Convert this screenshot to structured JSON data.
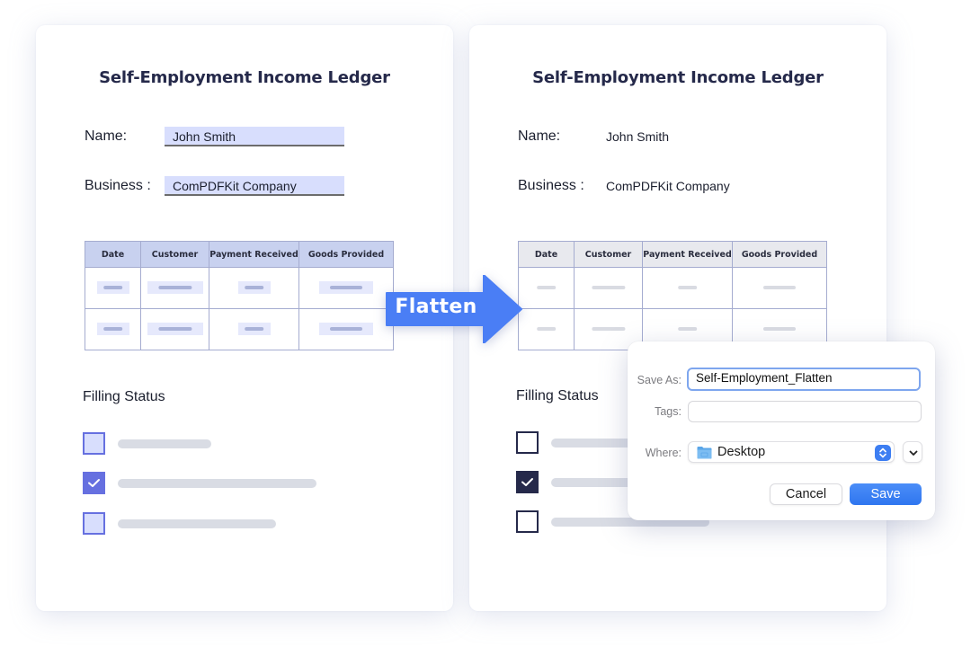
{
  "flatten_label": "Flatten",
  "colors": {
    "accent": "#4a7ef5",
    "filled_field_bg": "#d8defd",
    "filled_checkbox": "#6670e0",
    "flat_checkbox": "#25294a",
    "title": "#25294a"
  },
  "documents": [
    {
      "state": "filled",
      "title": "Self-Employment Income Ledger",
      "fields": [
        {
          "label": "Name:",
          "value": "John Smith"
        },
        {
          "label": "Business :",
          "value": "ComPDFKit Company"
        }
      ],
      "table": {
        "columns": [
          "Date",
          "Customer",
          "Payment Received",
          "Goods Provided"
        ],
        "rows": 2
      },
      "status_title": "Filling Status",
      "checkboxes": [
        {
          "checked": false
        },
        {
          "checked": true
        },
        {
          "checked": false
        }
      ]
    },
    {
      "state": "flattened",
      "title": "Self-Employment Income Ledger",
      "fields": [
        {
          "label": "Name:",
          "value": "John Smith"
        },
        {
          "label": "Business :",
          "value": "ComPDFKit Company"
        }
      ],
      "table": {
        "columns": [
          "Date",
          "Customer",
          "Payment Received",
          "Goods Provided"
        ],
        "rows": 2
      },
      "status_title": "Filling Status",
      "checkboxes": [
        {
          "checked": false
        },
        {
          "checked": true
        },
        {
          "checked": false
        }
      ]
    }
  ],
  "save_dialog": {
    "save_as_label": "Save As:",
    "save_as_value": "Self-Employment_Flatten",
    "tags_label": "Tags:",
    "tags_value": "",
    "where_label": "Where:",
    "where_value": "Desktop",
    "where_icon": "folder-icon",
    "cancel_label": "Cancel",
    "save_label": "Save"
  }
}
